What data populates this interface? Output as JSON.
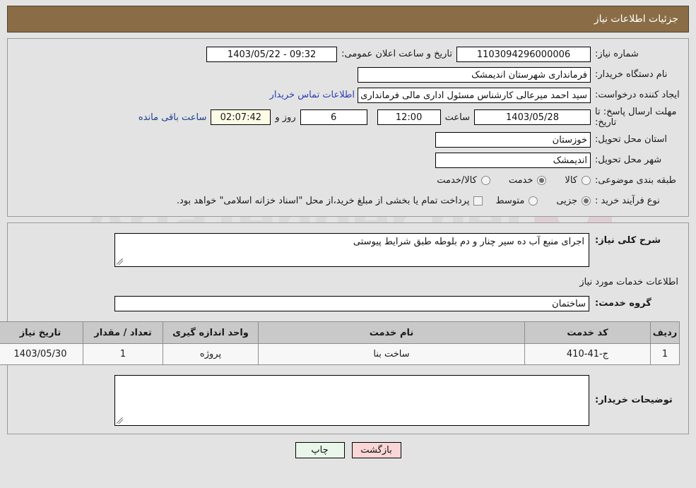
{
  "header": {
    "title": "جزئیات اطلاعات نیاز"
  },
  "main_form": {
    "need_number_label": "شماره نیاز:",
    "need_number_value": "1103094296000006",
    "public_announce_label": "تاریخ و ساعت اعلان عمومی:",
    "public_announce_value": "09:32 - 1403/05/22",
    "buyer_org_label": "نام دستگاه خریدار:",
    "buyer_org_value": "فرمانداری شهرستان اندیمشک",
    "creator_label": "ایجاد کننده درخواست:",
    "creator_value": "سید احمد میرعالی کارشناس مسئول اداری مالی فرمانداری شهرستان اندیمشک",
    "contact_link": "اطلاعات تماس خریدار",
    "deadline_label": "مهلت ارسال پاسخ: تا تاریخ:",
    "deadline_date": "1403/05/28",
    "deadline_hour_label": "ساعت",
    "deadline_time": "12:00",
    "remaining_days": "6",
    "remaining_days_suffix": "روز و",
    "remaining_countdown": "02:07:42",
    "remaining_suffix": "ساعت باقی مانده",
    "province_label": "استان محل تحویل:",
    "province_value": "خوزستان",
    "city_label": "شهر محل تحویل:",
    "city_value": "اندیمشک",
    "category_label": "طبقه بندی موضوعی:",
    "category_options": [
      {
        "label": "کالا",
        "checked": false
      },
      {
        "label": "خدمت",
        "checked": true
      },
      {
        "label": "کالا/خدمت",
        "checked": false
      }
    ],
    "process_label": "نوع فرآیند خرید :",
    "process_options": [
      {
        "label": "جزیی",
        "checked": true
      },
      {
        "label": "متوسط",
        "checked": false
      }
    ],
    "treasury_checkbox_checked": false,
    "treasury_note": "پرداخت تمام یا بخشی از مبلغ خرید،از محل \"اسناد خزانه اسلامی\" خواهد بود."
  },
  "detail": {
    "need_desc_label": "شرح کلی نیاز:",
    "need_desc_value": "اجرای منبع آب ده سیر چنار و دم بلوطه طبق شرایط پیوستی",
    "services_section_title": "اطلاعات خدمات مورد نیاز",
    "service_group_label": "گروه خدمت:",
    "service_group_value": "ساختمان",
    "table": {
      "columns": [
        "ردیف",
        "کد خدمت",
        "نام خدمت",
        "واحد اندازه گیری",
        "تعداد / مقدار",
        "تاریخ نیاز"
      ],
      "rows": [
        {
          "radif": "1",
          "code": "ج-41-410",
          "name": "ساخت بنا",
          "unit": "پروژه",
          "quantity": "1",
          "need_date": "1403/05/30"
        }
      ]
    },
    "buyer_notes_label": "توضیحات خریدار:",
    "buyer_notes_value": ""
  },
  "footer": {
    "print_label": "چاپ",
    "back_label": "بازگشت"
  },
  "watermark": {
    "text": "AriaTender.net"
  }
}
